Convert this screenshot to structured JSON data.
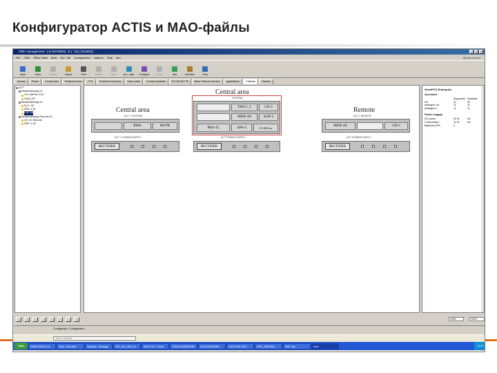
{
  "slide": {
    "title": "Конфигуратор ACTIS и МАО-файлы"
  },
  "window": {
    "title": "Offer management - [ EAMVDB26...5 ] : 111 [ RU8SG]",
    "brand": "Alcatel-Lucent"
  },
  "menu": [
    "File",
    "Offer",
    "Office Fatal",
    "Multi",
    "Opt. Tab",
    "Configuration",
    "Options",
    "Help",
    "Info"
  ],
  "toolbar": {
    "items": [
      {
        "label": "Open",
        "icon": "open-icon",
        "dim": false
      },
      {
        "label": "Save",
        "icon": "save-icon",
        "dim": false
      },
      {
        "label": "Export",
        "icon": "export-icon",
        "dim": true
      },
      {
        "label": "Import",
        "icon": "import-icon",
        "dim": false
      },
      {
        "label": "Print",
        "icon": "print-icon",
        "dim": false
      },
      {
        "label": "Delete",
        "icon": "delete-icon",
        "dim": true
      },
      {
        "label": "Redo",
        "icon": "redo-icon",
        "dim": true
      },
      {
        "label": "Acc. valid.",
        "icon": "check-icon",
        "dim": false
      },
      {
        "label": "Configure",
        "icon": "configure-icon",
        "dim": false
      },
      {
        "label": "Dele",
        "icon": "delete-icon",
        "dim": true
      },
      {
        "label": "Add",
        "icon": "add-icon",
        "dim": false
      },
      {
        "label": "Add Box",
        "icon": "box-icon",
        "dim": false
      },
      {
        "label": "Help",
        "icon": "help-icon",
        "dim": false
      }
    ]
  },
  "tabs": [
    "Access",
    "Phone",
    "Central area",
    "Peripheral area",
    "PCS",
    "Peripheral functions",
    "Voice cards",
    "Connect Quantity",
    "AT-GAC/AT-TB",
    "Basic Telecom function",
    "Applications",
    "Cabinets",
    "Options"
  ],
  "active_tab_index": 11,
  "tree": {
    "items": [
      {
        "label": "ACT",
        "indent": 0,
        "kind": "node",
        "selected": false
      },
      {
        "label": "MediaGateway 01",
        "indent": 1,
        "kind": "node",
        "selected": false
      },
      {
        "label": "CS: NetPbx 2-02",
        "indent": 2,
        "kind": "file",
        "selected": false
      },
      {
        "label": "SX(2) CP",
        "indent": 2,
        "kind": "file",
        "selected": false
      },
      {
        "label": "MediaGateway 02",
        "indent": 1,
        "kind": "node",
        "selected": false
      },
      {
        "label": "DLC: 02",
        "indent": 2,
        "kind": "file",
        "selected": false
      },
      {
        "label": "RM1 1-01",
        "indent": 2,
        "kind": "file",
        "selected": false
      },
      {
        "label": "CSP-08",
        "indent": 2,
        "kind": "file",
        "selected": true
      },
      {
        "label": "MediaGateway Remote 01",
        "indent": 1,
        "kind": "node",
        "selected": false
      },
      {
        "label": "XS: 01 Remote",
        "indent": 2,
        "kind": "file",
        "selected": false
      },
      {
        "label": "RMT 1-02",
        "indent": 2,
        "kind": "file",
        "selected": false
      }
    ]
  },
  "diagram": {
    "central_left": {
      "title": "Central area",
      "sub": "ACT 1 CENTRAL",
      "slots": [
        "RMA",
        "MOTB"
      ],
      "sub2": "ACT 1 POWER SUPPLY",
      "psu": "RECTIFIER"
    },
    "central_mid": {
      "title": "Central area",
      "sub": "CENTRAL",
      "slots_row1": [
        "TAD-C_1",
        "GD-3"
      ],
      "slots_row2": [
        "MINI-4/8",
        "SLIP-2"
      ],
      "slots_row3": [
        "PRA-T2",
        "APA-4",
        "CS 48/4 ext"
      ],
      "sub2": "ACT POWER SUPPLY",
      "psu": "RECTIFIER"
    },
    "remote": {
      "title": "Remote",
      "sub": "ACT 1 REMOTE",
      "slots": [
        "MINI-4/8",
        "GD-3"
      ],
      "sub2": "ACT POWER SUPPLY",
      "psu": "RECTIFIER"
    }
  },
  "props": {
    "heading": "OmniPCX Enterprise",
    "section1": "Accesses",
    "col1": "Supported",
    "col2": "Available",
    "rows1": [
      {
        "k": "DG",
        "a": "21",
        "b": "22"
      },
      {
        "k": "  Analogue UA",
        "a": "11",
        "b": "11"
      },
      {
        "k": "  Analogue Z",
        "a": "11",
        "b": "11"
      }
    ],
    "section2": "Power supply",
    "rows2": [
      {
        "k": "DC power",
        "a": "53 W",
        "b": "No"
      },
      {
        "k": "Consumption",
        "a": "31 W",
        "b": "No"
      },
      {
        "k": "Batteries-DPS",
        "a": "0",
        "b": ""
      }
    ]
  },
  "bottom": {
    "zoom_left": "100%",
    "zoom_right": "100%"
  },
  "status": {
    "text": "Configurator: Configuration"
  },
  "taskbar": {
    "address_placeholder": "Search Desktop",
    "start": "Start",
    "tasks": [
      "EAMS-2008 Rp 14",
      "Inbox - Microsoft",
      "Inpadoop - Message",
      "OFC_201_Offer_fin",
      "Sta270 Ver - Power",
      "UTALM UAMENOPIE",
      "OTALM MODEMS",
      "USD ICEAL DOC",
      "INFO_2008 REQ",
      "GRIT xlsx",
      "Actis"
    ],
    "active_task": 10,
    "clock": "10:22"
  }
}
